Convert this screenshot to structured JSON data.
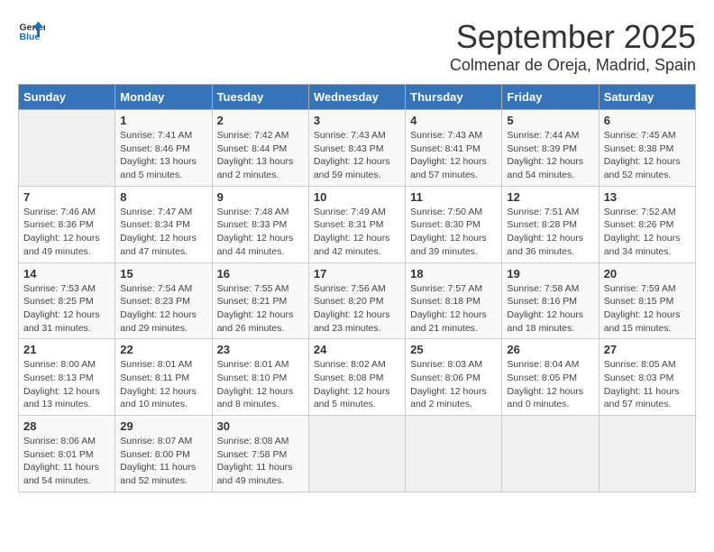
{
  "header": {
    "logo_line1": "General",
    "logo_line2": "Blue",
    "month": "September 2025",
    "location": "Colmenar de Oreja, Madrid, Spain"
  },
  "weekdays": [
    "Sunday",
    "Monday",
    "Tuesday",
    "Wednesday",
    "Thursday",
    "Friday",
    "Saturday"
  ],
  "weeks": [
    [
      {
        "day": "",
        "info": ""
      },
      {
        "day": "1",
        "info": "Sunrise: 7:41 AM\nSunset: 8:46 PM\nDaylight: 13 hours\nand 5 minutes."
      },
      {
        "day": "2",
        "info": "Sunrise: 7:42 AM\nSunset: 8:44 PM\nDaylight: 13 hours\nand 2 minutes."
      },
      {
        "day": "3",
        "info": "Sunrise: 7:43 AM\nSunset: 8:43 PM\nDaylight: 12 hours\nand 59 minutes."
      },
      {
        "day": "4",
        "info": "Sunrise: 7:43 AM\nSunset: 8:41 PM\nDaylight: 12 hours\nand 57 minutes."
      },
      {
        "day": "5",
        "info": "Sunrise: 7:44 AM\nSunset: 8:39 PM\nDaylight: 12 hours\nand 54 minutes."
      },
      {
        "day": "6",
        "info": "Sunrise: 7:45 AM\nSunset: 8:38 PM\nDaylight: 12 hours\nand 52 minutes."
      }
    ],
    [
      {
        "day": "7",
        "info": "Sunrise: 7:46 AM\nSunset: 8:36 PM\nDaylight: 12 hours\nand 49 minutes."
      },
      {
        "day": "8",
        "info": "Sunrise: 7:47 AM\nSunset: 8:34 PM\nDaylight: 12 hours\nand 47 minutes."
      },
      {
        "day": "9",
        "info": "Sunrise: 7:48 AM\nSunset: 8:33 PM\nDaylight: 12 hours\nand 44 minutes."
      },
      {
        "day": "10",
        "info": "Sunrise: 7:49 AM\nSunset: 8:31 PM\nDaylight: 12 hours\nand 42 minutes."
      },
      {
        "day": "11",
        "info": "Sunrise: 7:50 AM\nSunset: 8:30 PM\nDaylight: 12 hours\nand 39 minutes."
      },
      {
        "day": "12",
        "info": "Sunrise: 7:51 AM\nSunset: 8:28 PM\nDaylight: 12 hours\nand 36 minutes."
      },
      {
        "day": "13",
        "info": "Sunrise: 7:52 AM\nSunset: 8:26 PM\nDaylight: 12 hours\nand 34 minutes."
      }
    ],
    [
      {
        "day": "14",
        "info": "Sunrise: 7:53 AM\nSunset: 8:25 PM\nDaylight: 12 hours\nand 31 minutes."
      },
      {
        "day": "15",
        "info": "Sunrise: 7:54 AM\nSunset: 8:23 PM\nDaylight: 12 hours\nand 29 minutes."
      },
      {
        "day": "16",
        "info": "Sunrise: 7:55 AM\nSunset: 8:21 PM\nDaylight: 12 hours\nand 26 minutes."
      },
      {
        "day": "17",
        "info": "Sunrise: 7:56 AM\nSunset: 8:20 PM\nDaylight: 12 hours\nand 23 minutes."
      },
      {
        "day": "18",
        "info": "Sunrise: 7:57 AM\nSunset: 8:18 PM\nDaylight: 12 hours\nand 21 minutes."
      },
      {
        "day": "19",
        "info": "Sunrise: 7:58 AM\nSunset: 8:16 PM\nDaylight: 12 hours\nand 18 minutes."
      },
      {
        "day": "20",
        "info": "Sunrise: 7:59 AM\nSunset: 8:15 PM\nDaylight: 12 hours\nand 15 minutes."
      }
    ],
    [
      {
        "day": "21",
        "info": "Sunrise: 8:00 AM\nSunset: 8:13 PM\nDaylight: 12 hours\nand 13 minutes."
      },
      {
        "day": "22",
        "info": "Sunrise: 8:01 AM\nSunset: 8:11 PM\nDaylight: 12 hours\nand 10 minutes."
      },
      {
        "day": "23",
        "info": "Sunrise: 8:01 AM\nSunset: 8:10 PM\nDaylight: 12 hours\nand 8 minutes."
      },
      {
        "day": "24",
        "info": "Sunrise: 8:02 AM\nSunset: 8:08 PM\nDaylight: 12 hours\nand 5 minutes."
      },
      {
        "day": "25",
        "info": "Sunrise: 8:03 AM\nSunset: 8:06 PM\nDaylight: 12 hours\nand 2 minutes."
      },
      {
        "day": "26",
        "info": "Sunrise: 8:04 AM\nSunset: 8:05 PM\nDaylight: 12 hours\nand 0 minutes."
      },
      {
        "day": "27",
        "info": "Sunrise: 8:05 AM\nSunset: 8:03 PM\nDaylight: 11 hours\nand 57 minutes."
      }
    ],
    [
      {
        "day": "28",
        "info": "Sunrise: 8:06 AM\nSunset: 8:01 PM\nDaylight: 11 hours\nand 54 minutes."
      },
      {
        "day": "29",
        "info": "Sunrise: 8:07 AM\nSunset: 8:00 PM\nDaylight: 11 hours\nand 52 minutes."
      },
      {
        "day": "30",
        "info": "Sunrise: 8:08 AM\nSunset: 7:58 PM\nDaylight: 11 hours\nand 49 minutes."
      },
      {
        "day": "",
        "info": ""
      },
      {
        "day": "",
        "info": ""
      },
      {
        "day": "",
        "info": ""
      },
      {
        "day": "",
        "info": ""
      }
    ]
  ]
}
